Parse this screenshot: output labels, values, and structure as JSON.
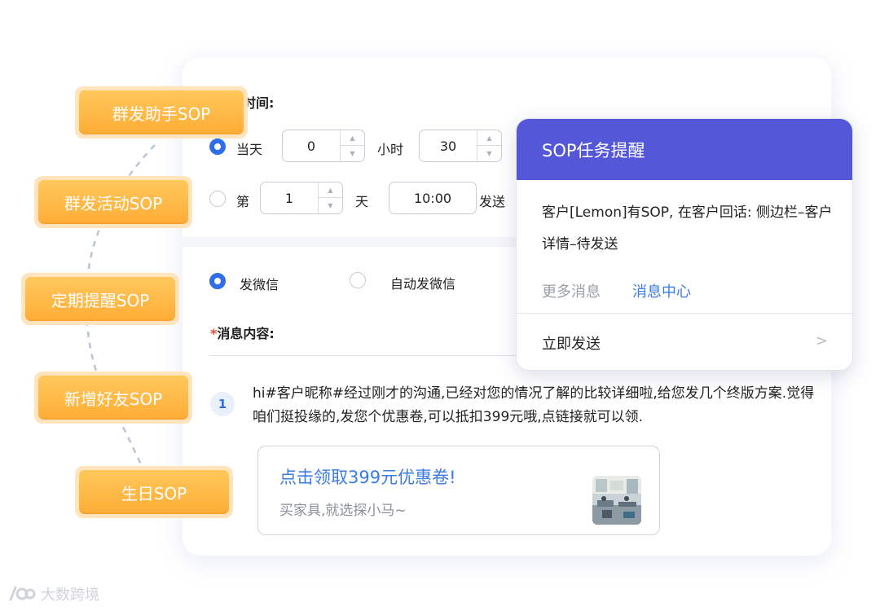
{
  "schedule": {
    "time_label": "时间:",
    "option_same_day": "当天",
    "hours_value": "0",
    "hours_unit": "小时",
    "minutes_value": "30",
    "option_day_prefix": "第",
    "day_value": "1",
    "day_unit": "天",
    "time_value": "10:00",
    "send_suffix": "发送"
  },
  "send_method": {
    "option_wechat": "发微信",
    "option_auto_wechat": "自动发微信"
  },
  "message": {
    "required_mark": "*",
    "label": "消息内容:",
    "step_number": "1",
    "text": "hi#客户昵称#经过刚才的沟通,已经对您的情况了解的比较详细啦,给您发几个终版方案.觉得咱们挺投缘的,发您个优惠卷,可以抵扣399元哦,点链接就可以领."
  },
  "coupon": {
    "title": "点击领取399元优惠卷!",
    "subtitle": "买家具,就选探小马~"
  },
  "popup": {
    "title": "SOP任务提醒",
    "body": "客户[Lemon]有SOP, 在客户回话: 侧边栏–客户详情–待发送",
    "more_messages": "更多消息",
    "message_center": "消息中心",
    "send_now": "立即发送"
  },
  "sop_tags": [
    "群发助手SOP",
    "群发活动SOP",
    "定期提醒SOP",
    "新增好友SOP",
    "生日SOP"
  ],
  "watermark": "大数跨境",
  "colors": {
    "accent_blue": "#2f6ee8",
    "popup_header": "#5458d8",
    "link_blue": "#3a7be4",
    "tag_orange": "#ffad36"
  }
}
